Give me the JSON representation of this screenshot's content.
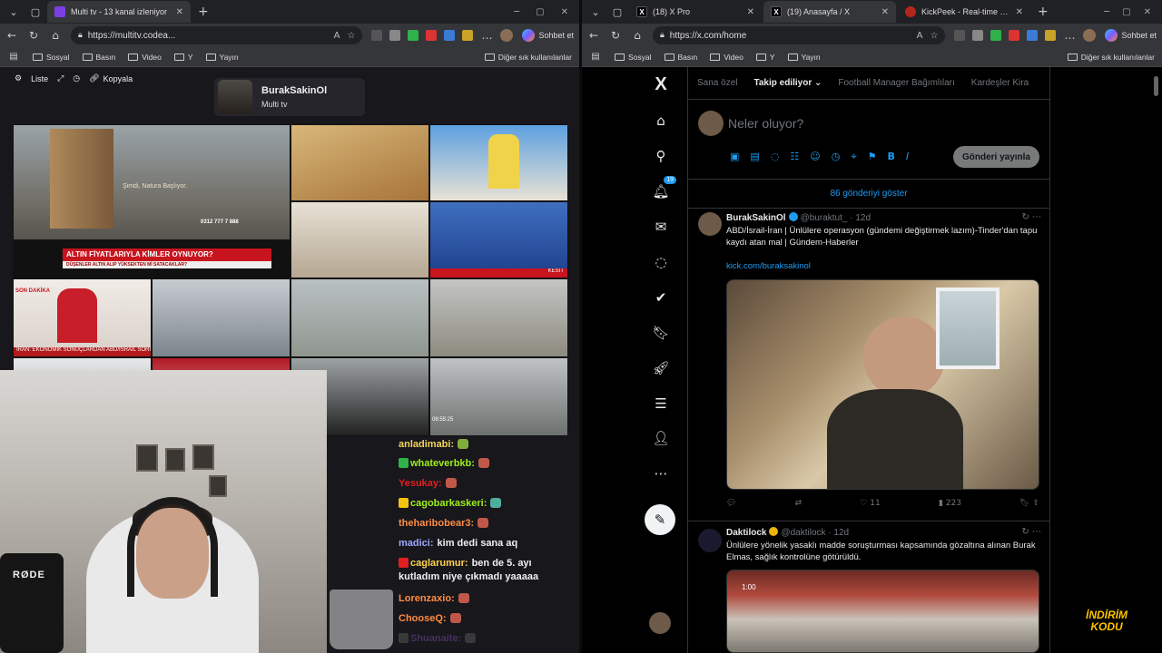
{
  "left_browser": {
    "tab_title": "Multi tv - 13 kanal izleniyor",
    "url": "https://multitv.codea...",
    "copilot_label": "Sohbet et",
    "bookmarks": [
      "Sosyal",
      "Basın",
      "Video",
      "Y",
      "Yayın"
    ],
    "bookmarks_other": "Diğer sık kullanılanlar"
  },
  "multitv": {
    "toolbar": {
      "list_label": "Liste",
      "copy_label": "Kopyala"
    },
    "channel_name": "BurakSakinOl",
    "channel_sub": "Multi tv",
    "cells": [
      {
        "caption": "ALTIN FİYATLARIYLA KİMLER OYNUYOR?",
        "sub": "DÜŞENLER ALTIN ALIP YÜKSEKTEN Mİ SATACAKLAR?",
        "overlay": "Şimdi, Natura Başlıyor.",
        "phone": "0312 777 7 888"
      },
      {
        "caption": "İRAN: EKONOMİK SONUÇLARDAN ABD/İSRAİL SORUMLU",
        "overlay": "SON DAKİKA"
      },
      {
        "caption": "KESİT",
        "overlay": ""
      },
      {
        "caption": "",
        "overlay": "08:55:25"
      }
    ]
  },
  "chat": {
    "messages": [
      {
        "user": "anladimabi:",
        "text": "",
        "color": "#f3d35c",
        "emote": "#7fae3b",
        "badge": ""
      },
      {
        "user": "whateverbkb:",
        "text": "",
        "color": "#9ef01a",
        "emote": "#c0584a",
        "badge": "#2fb24a"
      },
      {
        "user": "Yesukay:",
        "text": "",
        "color": "#e02020",
        "emote": "#c0584a",
        "badge": ""
      },
      {
        "user": "cagobarkaskeri:",
        "text": "",
        "color": "#9ef01a",
        "emote": "#4fae9c",
        "badge": "#f1c40f"
      },
      {
        "user": "theharibobear3:",
        "text": "",
        "color": "#ff8c42",
        "emote": "#c0584a",
        "badge": ""
      },
      {
        "user": "madici:",
        "text": "kim dedi sana aq",
        "color": "#9fa8ff",
        "emote": "",
        "badge": ""
      },
      {
        "user": "caglarumur:",
        "text": "ben de 5. ayı",
        "text2": "kutladım niye çıkmadı yaaaaa",
        "color": "#ffd34d",
        "emote": "",
        "badge": "#e02020"
      },
      {
        "user": "Lorenzaxio:",
        "text": "",
        "color": "#ff8c42",
        "emote": "#c0584a",
        "badge": ""
      },
      {
        "user": "ChooseQ:",
        "text": "",
        "color": "#ff8c42",
        "emote": "#c0584a",
        "badge": ""
      },
      {
        "user": "Shuanaite:",
        "text": "",
        "color": "#9b5fe0",
        "emote": "#777777",
        "badge": "#777777"
      }
    ],
    "cam_brand": "RØDE"
  },
  "right_browser": {
    "tabs": [
      {
        "title": "(18) X Pro"
      },
      {
        "title": "(19) Anasayfa / X"
      },
      {
        "title": "KickPeek - Real-time URL Crawl"
      }
    ],
    "url": "https://x.com/home",
    "copilot_label": "Sohbet et",
    "bookmarks": [
      "Sosyal",
      "Basın",
      "Video",
      "Y",
      "Yayın"
    ],
    "bookmarks_other": "Diğer sık kullanılanlar"
  },
  "x": {
    "notification_count": "19",
    "feed_tabs": [
      "Sana özel",
      "Takip ediliyor",
      "Football Manager Bağımlıları",
      "Kardeşler Kira"
    ],
    "compose_placeholder": "Neler oluyor?",
    "post_button": "Gönderi yayınla",
    "show_more": "86 gönderiyi göster",
    "tweets": [
      {
        "name": "BurakSakinOl",
        "handle": "@buraktut_ · 12d",
        "text": "ABD/İsrail-İran | Ünlülere operasyon (gündemi değiştirmek lazım)-Tinder'dan tapu kaydı atan mal | Gündem-Haberler",
        "link": "kick.com/buraksakinol",
        "retweets": "",
        "likes": "11",
        "views": "223"
      },
      {
        "name": "Daktilock",
        "handle": "@daktilock · 12d",
        "text": "Ünlülere yönelik yasaklı madde soruşturması kapsamında gözaltına alınan Burak Elmas, sağlık kontrolüne götürüldü.",
        "video_time": "1:00"
      }
    ]
  },
  "promo": {
    "line1": "İNDİRİM",
    "line2": "KODU"
  },
  "colors": {
    "x_blue": "#1d9bf0",
    "browser_dark": "#202124",
    "chat_bg": "#18171c"
  }
}
